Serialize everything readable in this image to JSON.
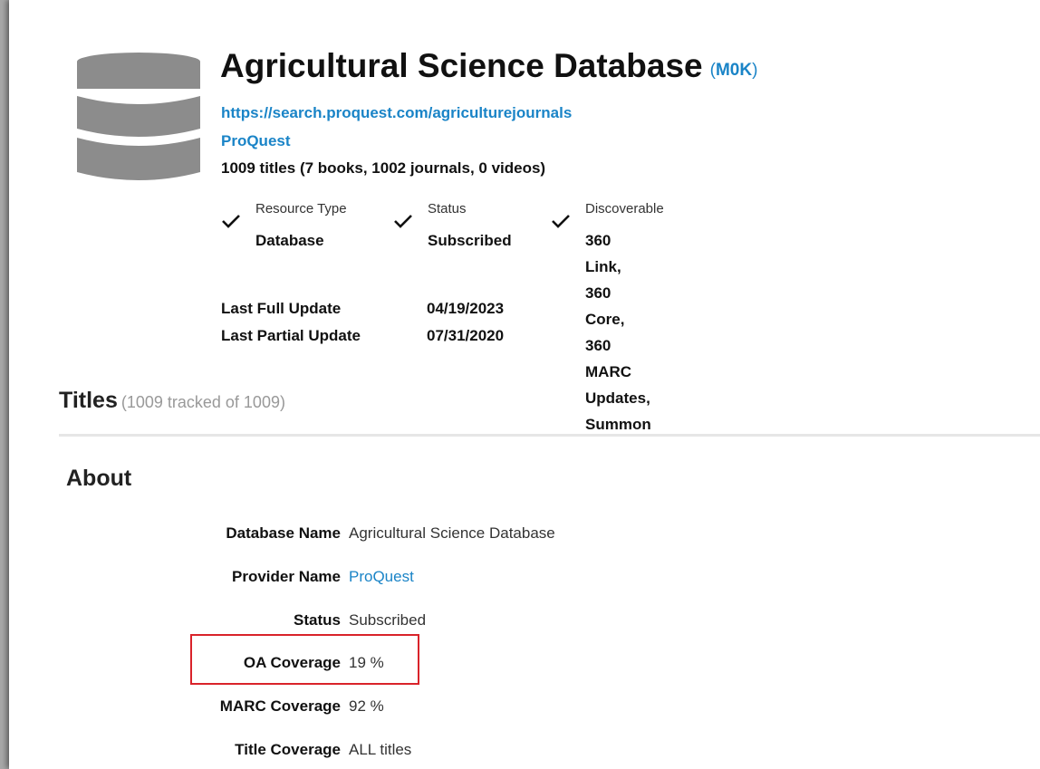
{
  "header": {
    "title": "Agricultural Science Database",
    "code": "M0K",
    "url": "https://search.proquest.com/agriculturejournals",
    "provider": "ProQuest",
    "title_counts": "1009 titles (7 books, 1002 journals, 0 videos)",
    "icon": "database-icon"
  },
  "attributes": [
    {
      "label": "Resource Type",
      "value": "Database"
    },
    {
      "label": "Status",
      "value": "Subscribed"
    },
    {
      "label": "Discoverable",
      "value_lines": [
        "360 Link, 360 Core, 360",
        "MARC Updates, Summon"
      ]
    }
  ],
  "updates": {
    "full_label": "Last Full Update",
    "full_value": "04/19/2023",
    "partial_label": "Last Partial Update",
    "partial_value": "07/31/2020"
  },
  "titles_section": {
    "heading": "Titles",
    "subtext": "(1009 tracked of 1009)"
  },
  "about": {
    "heading": "About",
    "rows": [
      {
        "label": "Database Name",
        "value": "Agricultural Science Database"
      },
      {
        "label": "Provider Name",
        "value": "ProQuest"
      },
      {
        "label": "Status",
        "value": "Subscribed"
      },
      {
        "label": "OA Coverage",
        "value": "19 %"
      },
      {
        "label": "MARC Coverage",
        "value": "92 %"
      },
      {
        "label": "Title Coverage",
        "value": "ALL titles"
      }
    ]
  },
  "colors": {
    "link": "#1a84c7",
    "highlight_border": "#d9232a",
    "icon_gray": "#8c8c8c"
  }
}
